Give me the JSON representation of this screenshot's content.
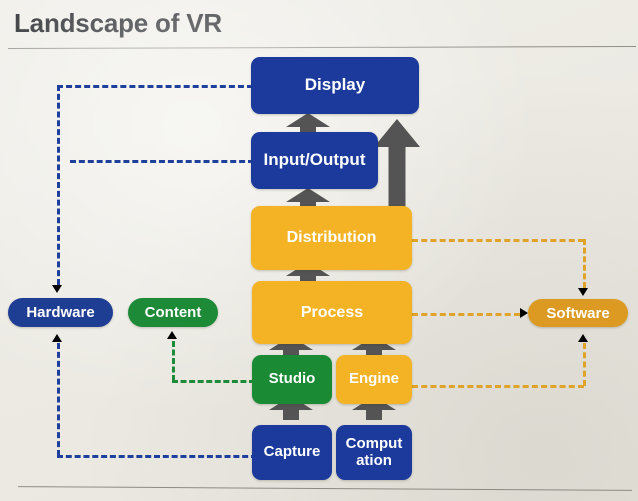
{
  "slide": {
    "title": "Landscape of VR",
    "background_color": "#ecead3",
    "divider_color": "#8e8c85"
  },
  "palette": {
    "blue": "#1b3a9c",
    "orange": "#f4b325",
    "green": "#1a8a34",
    "pill_blue": "#1e3e94",
    "pill_green": "#1c8a36",
    "pill_orange": "#dd9a22",
    "arrow_gray": "#545454"
  },
  "stack": {
    "display": "Display",
    "input_output": "Input/Output",
    "distribution": "Distribution",
    "process": "Process",
    "studio": "Studio",
    "engine": "Engine",
    "capture": "Capture",
    "computation_line1": "Comput",
    "computation_line2": "ation"
  },
  "categories": {
    "hardware": "Hardware",
    "content": "Content",
    "software": "Software"
  },
  "chart_data": {
    "type": "diagram",
    "title": "Landscape of VR",
    "nodes": [
      {
        "id": "display",
        "label": "Display",
        "color": "blue",
        "row": 1,
        "group": "hardware"
      },
      {
        "id": "input_output",
        "label": "Input/Output",
        "color": "blue",
        "row": 2,
        "group": "hardware"
      },
      {
        "id": "distribution",
        "label": "Distribution",
        "color": "orange",
        "row": 3,
        "group": "software"
      },
      {
        "id": "process",
        "label": "Process",
        "color": "orange",
        "row": 4,
        "group": "software"
      },
      {
        "id": "studio",
        "label": "Studio",
        "color": "green",
        "row": 5,
        "group": "content"
      },
      {
        "id": "engine",
        "label": "Engine",
        "color": "orange",
        "row": 5,
        "group": "software"
      },
      {
        "id": "capture",
        "label": "Capture",
        "color": "blue",
        "row": 6,
        "group": "hardware"
      },
      {
        "id": "computation",
        "label": "Computation",
        "color": "blue",
        "row": 6,
        "group": "hardware"
      },
      {
        "id": "hardware",
        "label": "Hardware",
        "color": "blue",
        "shape": "pill"
      },
      {
        "id": "content",
        "label": "Content",
        "color": "green",
        "shape": "pill"
      },
      {
        "id": "software",
        "label": "Software",
        "color": "orange",
        "shape": "pill"
      }
    ],
    "edges": [
      {
        "from": "input_output",
        "to": "display",
        "style": "solid",
        "color": "gray"
      },
      {
        "from": "distribution",
        "to": "input_output",
        "style": "solid",
        "color": "gray"
      },
      {
        "from": "distribution",
        "to": "display",
        "style": "solid",
        "color": "gray"
      },
      {
        "from": "process",
        "to": "distribution",
        "style": "solid",
        "color": "gray"
      },
      {
        "from": "studio",
        "to": "process",
        "style": "solid",
        "color": "gray"
      },
      {
        "from": "engine",
        "to": "process",
        "style": "solid",
        "color": "gray"
      },
      {
        "from": "capture",
        "to": "studio",
        "style": "solid",
        "color": "gray"
      },
      {
        "from": "computation",
        "to": "engine",
        "style": "solid",
        "color": "gray"
      },
      {
        "from": "display",
        "to": "hardware",
        "style": "dashed",
        "color": "blue"
      },
      {
        "from": "input_output",
        "to": "hardware",
        "style": "dashed",
        "color": "blue"
      },
      {
        "from": "capture",
        "to": "hardware",
        "style": "dashed",
        "color": "blue"
      },
      {
        "from": "studio",
        "to": "content",
        "style": "dashed",
        "color": "green"
      },
      {
        "from": "distribution",
        "to": "software",
        "style": "dashed",
        "color": "orange"
      },
      {
        "from": "process",
        "to": "software",
        "style": "dashed",
        "color": "orange"
      },
      {
        "from": "engine",
        "to": "software",
        "style": "dashed",
        "color": "orange"
      }
    ]
  }
}
